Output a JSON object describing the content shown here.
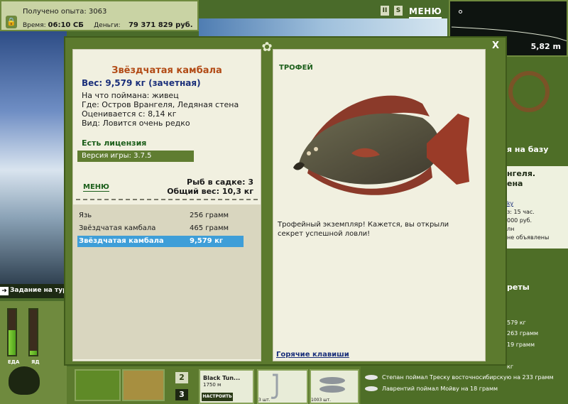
{
  "topbar": {
    "experience_label": "Получено опыта:",
    "experience_value": "3063",
    "time_label": "Время:",
    "time_value": "06:10 СБ",
    "money_label": "Деньги:",
    "money_value": "79 371 829 руб."
  },
  "controls": {
    "pause": "II",
    "sound": "S",
    "menu": "МЕНЮ"
  },
  "depth": {
    "value": "5,82 m"
  },
  "scene": {
    "task": "Задание на тур"
  },
  "bars": {
    "food_label": "ЕДА",
    "poison_label": "ЯД",
    "food_level": 0.55,
    "poison_level": 0.1
  },
  "bottom": {
    "num2": "2",
    "num3": "3",
    "line_name": "Black Tun...",
    "line_length": "1750 м",
    "tune_button": "НАСТРОИТЬ",
    "hook_count": "3 шт.",
    "bait_count": "1003 шт."
  },
  "right": {
    "to_base": "я на базу",
    "base_title_1": "нгеля.",
    "base_title_2": "ена",
    "line1": "ky",
    "line2": "з: 15 час.",
    "line3": "000 руб.",
    "line4": "лн",
    "line5": "не объявлены",
    "secrets": "реты"
  },
  "news": [
    {
      "text": "579 кг"
    },
    {
      "text": "263 грамм"
    },
    {
      "text": "19 грамм"
    },
    {
      "text": "кг"
    },
    {
      "text": "Степан поймал Треску восточносибирскую на 233 грамм"
    },
    {
      "text": "Лаврентий поймал Мойву на 18 грамм"
    }
  ],
  "modal": {
    "close": "X",
    "fish_name": "Звёздчатая камбала",
    "weight_line": "Вес: 9,579 кг (зачетная)",
    "caught_on": "На что поймана: живец",
    "where": "Где: Остров Врангеля, Ледяная стена",
    "estimated": "Оценивается с: 8,14 кг",
    "species": "Вид: Ловится очень редко",
    "license": "Есть лицензия",
    "version": "Версия игры: 3.7.5",
    "menu_label": "МЕНЮ",
    "in_cage": "Рыб в садке: 3",
    "total_weight": "Общий вес: 10,3 кг",
    "trophy_label": "ТРОФЕЙ",
    "trophy_text": "Трофейный экземпляр! Кажется, вы открыли секрет успешной ловли!",
    "hotkeys": "Горячие клавиши",
    "catches": [
      {
        "name": "Язь",
        "weight": "256 грамм",
        "selected": false
      },
      {
        "name": "Звёздчатая камбала",
        "weight": "465 грамм",
        "selected": false
      },
      {
        "name": "Звёздчатая камбала",
        "weight": "9,579 кг",
        "selected": true
      }
    ]
  }
}
